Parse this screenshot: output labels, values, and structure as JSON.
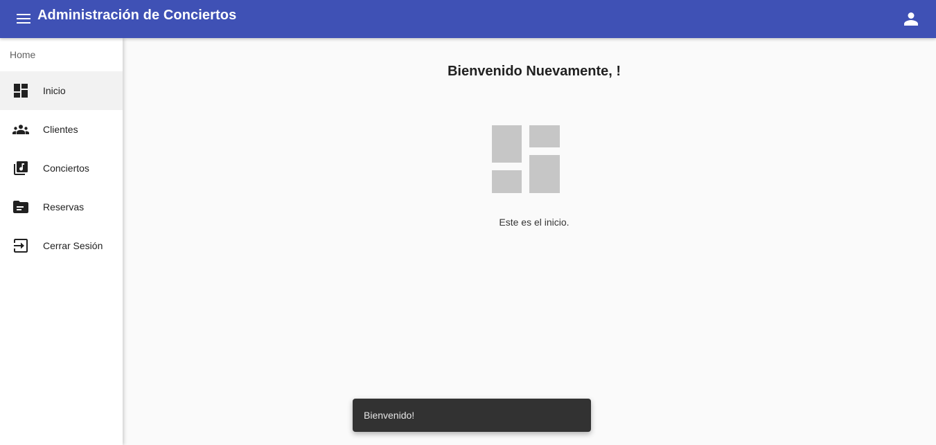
{
  "toolbar": {
    "title": "Administración de Conciertos",
    "menu_icon": "menu-icon",
    "account_icon": "person-icon",
    "color": "#3f51b5"
  },
  "sidebar": {
    "header": "Home",
    "items": [
      {
        "label": "Inicio",
        "icon": "dashboard-icon",
        "active": true
      },
      {
        "label": "Clientes",
        "icon": "groups-icon",
        "active": false
      },
      {
        "label": "Conciertos",
        "icon": "library-music-icon",
        "active": false
      },
      {
        "label": "Reservas",
        "icon": "folder-icon",
        "active": false
      },
      {
        "label": "Cerrar Sesión",
        "icon": "logout-icon",
        "active": false
      }
    ]
  },
  "main": {
    "title": "Bienvenido Nuevamente, !",
    "hero_icon": "dashboard-placeholder-icon",
    "text": "Este es el inicio."
  },
  "snackbar": {
    "message": "Bienvenido!"
  }
}
